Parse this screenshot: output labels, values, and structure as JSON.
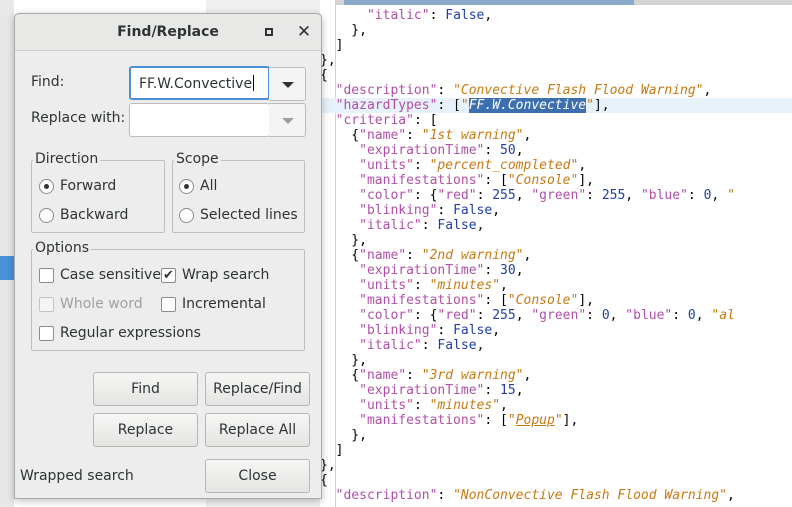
{
  "dialog": {
    "title": "Find/Replace",
    "find_label": "Find:",
    "find_value": "FF.W.Convective",
    "replace_label": "Replace with:",
    "replace_value": "",
    "direction": {
      "title": "Direction",
      "forward": "Forward",
      "backward": "Backward",
      "selected": "forward"
    },
    "scope": {
      "title": "Scope",
      "all": "All",
      "selected_lines": "Selected lines",
      "selected": "all"
    },
    "options": {
      "title": "Options",
      "case_sensitive": "Case sensitive",
      "wrap_search": "Wrap search",
      "whole_word": "Whole word",
      "incremental": "Incremental",
      "regular_expressions": "Regular expressions"
    },
    "buttons": {
      "find": "Find",
      "replace_find": "Replace/Find",
      "replace": "Replace",
      "replace_all": "Replace All",
      "close": "Close"
    },
    "status": "Wrapped search"
  },
  "editor": {
    "lines": [
      "      \"italic\": False,",
      "    },",
      "  ]",
      "},",
      "{",
      "  \"description\": \"Convective Flash Flood Warning\",",
      "  \"hazardTypes\": [\"FF.W.Convective\"],",
      "  \"criteria\": [",
      "    {\"name\": \"1st warning\",",
      "     \"expirationTime\": 50,",
      "     \"units\": \"percent_completed\",",
      "     \"manifestations\": [\"Console\"],",
      "     \"color\": {\"red\": 255, \"green\": 255, \"blue\": 0, \"",
      "     \"blinking\": False,",
      "     \"italic\": False,",
      "    },",
      "    {\"name\": \"2nd warning\",",
      "     \"expirationTime\": 30,",
      "     \"units\": \"minutes\",",
      "     \"manifestations\": [\"Console\"],",
      "     \"color\": {\"red\": 255, \"green\": 0, \"blue\": 0, \"al",
      "     \"blinking\": False,",
      "     \"italic\": False,",
      "    },",
      "    {\"name\": \"3rd warning\",",
      "     \"expirationTime\": 15,",
      "     \"units\": \"minutes\",",
      "     \"manifestations\": [\"Popup\"],",
      "    },",
      "  ]",
      "},",
      "{",
      "  \"description\": \"NonConvective Flash Flood Warning\","
    ]
  }
}
